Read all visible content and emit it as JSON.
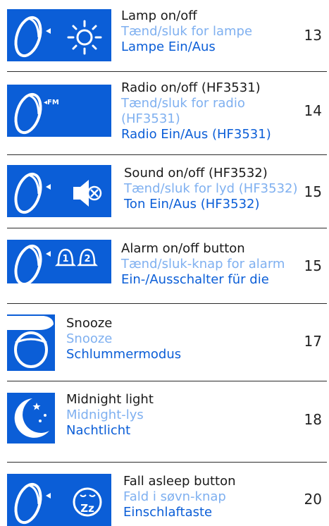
{
  "items": [
    {
      "en": "Lamp on/off",
      "da": "Tænd/sluk for lampe",
      "de": "Lampe Ein/Aus",
      "page": "13",
      "icon": "lamp-icon"
    },
    {
      "en": "Radio on/off (HF3531)",
      "da": "Tænd/sluk for radio (HF3531)",
      "de": "Radio Ein/Aus (HF3531)",
      "page": "14",
      "icon": "radio-icon",
      "icon_label": "◂FM"
    },
    {
      "en": "Sound on/off (HF3532)",
      "da": "Tænd/sluk for lyd (HF3532)",
      "de": "Ton Ein/Aus (HF3532)",
      "page": "15",
      "icon": "sound-mute-icon"
    },
    {
      "en": "Alarm on/off button",
      "da": "Tænd/sluk-knap for alarm",
      "de": "Ein-/Ausschalter für die",
      "page": "15",
      "icon": "alarm-bells-icon",
      "icon_label_1": "1",
      "icon_label_2": "2"
    },
    {
      "en": "Snooze",
      "da": "Snooze",
      "de": "Schlummermodus",
      "page": "17",
      "icon": "snooze-hand-icon"
    },
    {
      "en": "Midnight light",
      "da": "Midnight-lys",
      "de": "Nachtlicht",
      "page": "18",
      "icon": "moon-stars-icon"
    },
    {
      "en": "Fall asleep button",
      "da": "Fald i søvn-knap",
      "de": "Einschlaftaste",
      "page": "20",
      "icon": "sleep-face-icon",
      "icon_label": "Zz"
    }
  ],
  "colors": {
    "accent": "#0b5ed7",
    "light_accent": "#7fb0f0",
    "text": "#1a1a1a"
  }
}
